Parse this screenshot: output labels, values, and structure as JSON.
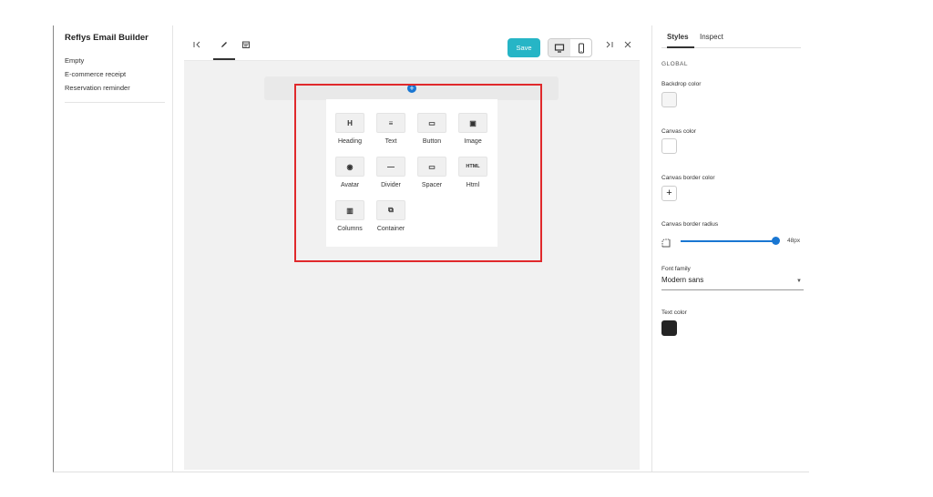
{
  "sidebar": {
    "title": "Reflys Email Builder",
    "items": [
      {
        "label": "Empty"
      },
      {
        "label": "E-commerce receipt"
      },
      {
        "label": "Reservation reminder"
      }
    ]
  },
  "toolbar": {
    "collapse_left_icon": "first-page-icon",
    "edit_icon": "pencil-icon",
    "preview_icon": "calendar-preview-icon",
    "save_label": "Save",
    "desktop_icon": "desktop-icon",
    "mobile_icon": "mobile-icon",
    "collapse_right_icon": "last-page-icon",
    "close_icon": "close-icon",
    "accent_color": "#26b5c6"
  },
  "blocks": [
    {
      "label": "Heading",
      "glyph": "H",
      "icon": "heading-icon"
    },
    {
      "label": "Text",
      "glyph": "≡",
      "icon": "text-icon"
    },
    {
      "label": "Button",
      "glyph": "▭",
      "icon": "button-icon"
    },
    {
      "label": "Image",
      "glyph": "▣",
      "icon": "image-icon"
    },
    {
      "label": "Avatar",
      "glyph": "◉",
      "icon": "avatar-icon"
    },
    {
      "label": "Divider",
      "glyph": "—",
      "icon": "divider-icon"
    },
    {
      "label": "Spacer",
      "glyph": "▭",
      "icon": "spacer-icon"
    },
    {
      "label": "Html",
      "glyph": "HTML",
      "icon": "html-icon"
    },
    {
      "label": "Columns",
      "glyph": "▥",
      "icon": "columns-icon"
    },
    {
      "label": "Container",
      "glyph": "⧉",
      "icon": "container-icon"
    }
  ],
  "styles_panel": {
    "tabs": [
      {
        "label": "Styles"
      },
      {
        "label": "Inspect"
      }
    ],
    "section": "GLOBAL",
    "backdrop_label": "Backdrop color",
    "backdrop_color": "#f5f5f5",
    "canvas_label": "Canvas color",
    "canvas_color": "#ffffff",
    "border_label": "Canvas border color",
    "radius_label": "Canvas border radius",
    "radius_value": "48px",
    "radius_fraction": 0.98,
    "font_label": "Font family",
    "font_value": "Modern sans",
    "text_color_label": "Text color",
    "text_color": "#242424"
  }
}
